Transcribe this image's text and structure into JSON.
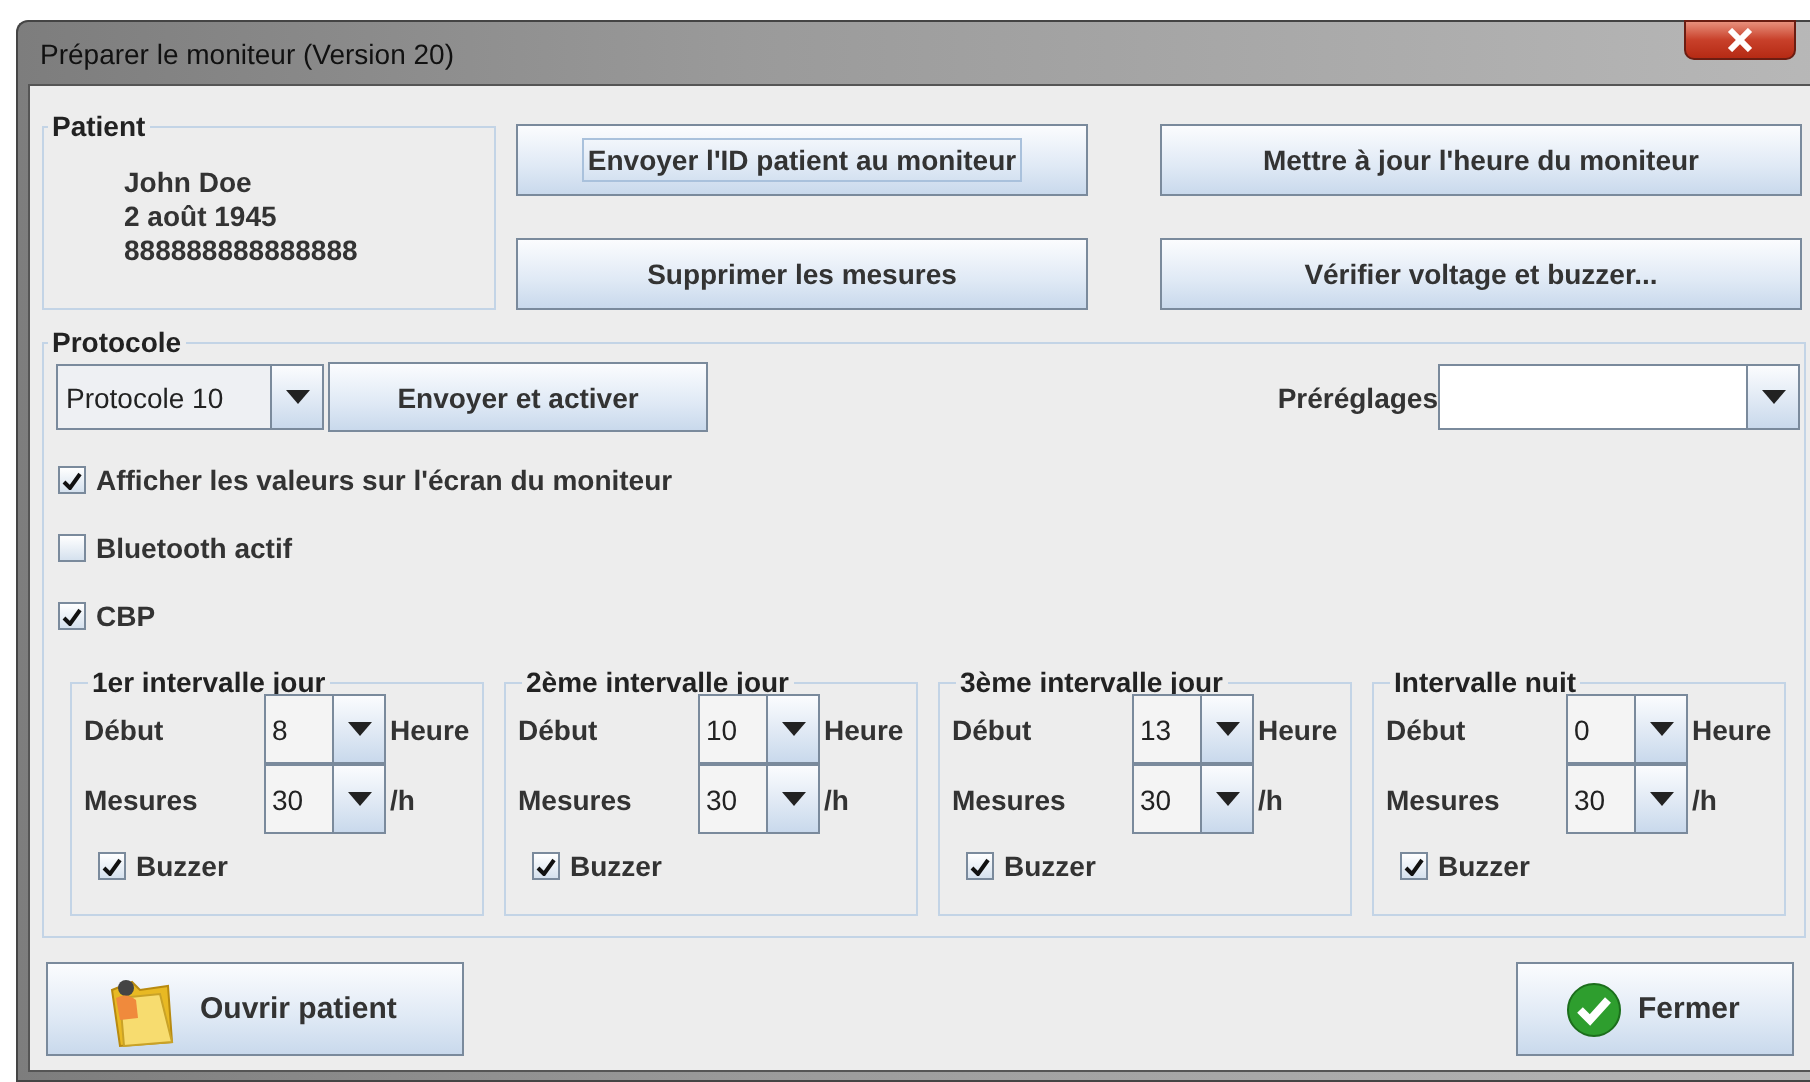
{
  "window": {
    "title": "Préparer le moniteur (Version 20)"
  },
  "patient": {
    "title": "Patient",
    "lines": [
      "John Doe",
      "2 août 1945",
      "888888888888888"
    ]
  },
  "actions": [
    {
      "label": "Envoyer l'ID patient au moniteur",
      "focused": true
    },
    {
      "label": "Mettre à jour l'heure du moniteur",
      "focused": false
    },
    {
      "label": "Supprimer les mesures",
      "focused": false
    },
    {
      "label": "Vérifier voltage et buzzer...",
      "focused": false
    }
  ],
  "protocol": {
    "title": "Protocole",
    "selector": "Protocole 10",
    "send_button": "Envoyer et activer",
    "presets_label": "Préréglages",
    "options": [
      {
        "label": "Afficher les valeurs sur l'écran du moniteur",
        "checked": true
      },
      {
        "label": "Bluetooth actif",
        "checked": false
      },
      {
        "label": "CBP",
        "checked": true
      }
    ],
    "intervals": [
      {
        "title": "1er intervalle jour",
        "start_label": "Début",
        "start_value": "8",
        "start_unit": "Heure",
        "count_label": "Mesures",
        "count_value": "30",
        "count_unit": "/h",
        "buzzer": {
          "label": "Buzzer",
          "checked": true
        }
      },
      {
        "title": "2ème intervalle jour",
        "start_label": "Début",
        "start_value": "10",
        "start_unit": "Heure",
        "count_label": "Mesures",
        "count_value": "30",
        "count_unit": "/h",
        "buzzer": {
          "label": "Buzzer",
          "checked": true
        }
      },
      {
        "title": "3ème intervalle jour",
        "start_label": "Début",
        "start_value": "13",
        "start_unit": "Heure",
        "count_label": "Mesures",
        "count_value": "30",
        "count_unit": "/h",
        "buzzer": {
          "label": "Buzzer",
          "checked": true
        }
      },
      {
        "title": "Intervalle nuit",
        "start_label": "Début",
        "start_value": "0",
        "start_unit": "Heure",
        "count_label": "Mesures",
        "count_value": "30",
        "count_unit": "/h",
        "buzzer": {
          "label": "Buzzer",
          "checked": true
        }
      }
    ]
  },
  "footer_buttons": [
    {
      "label": "Ouvrir patient",
      "kind": "open"
    },
    {
      "label": "Fermer",
      "kind": "close"
    }
  ]
}
